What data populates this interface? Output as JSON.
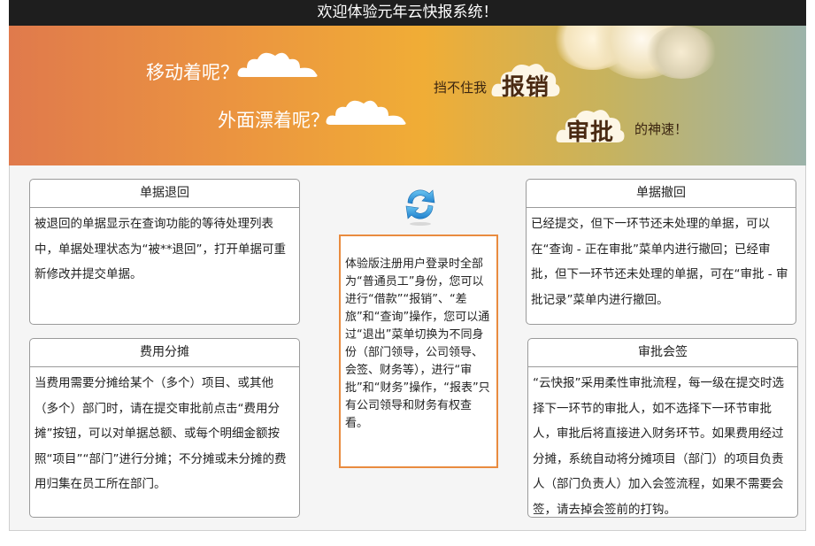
{
  "header": {
    "title": "欢迎体验元年云快报系统！"
  },
  "banner": {
    "line1": "移动着呢？",
    "line2": "外面漂着呢？",
    "cant_stop": "挡不住我",
    "word_reimburse": "报销",
    "word_approve": "审批",
    "speed": "的神速！"
  },
  "cards": {
    "returned": {
      "title": "单据退回",
      "body": "被退回的单据显示在查询功能的等待处理列表中，单据处理状态为“被**退回”，打开单据可重新修改并提交单据。"
    },
    "withdraw": {
      "title": "单据撤回",
      "body": "已经提交，但下一环节还未处理的单据，可以在“查询 - 正在审批”菜单内进行撤回；已经审批，但下一环节还未处理的单据，可在“审批 - 审批记录”菜单内进行撤回。"
    },
    "allocation": {
      "title": "费用分摊",
      "body": "当费用需要分摊给某个（多个）项目、或其他（多个）部门时，请在提交审批前点击“费用分摊”按钮，可以对单据总额、或每个明细金额按照“项目”“部门”进行分摊；不分摊或未分摊的费用归集在员工所在部门。"
    },
    "countersign": {
      "title": "审批会签",
      "body": "“云快报”采用柔性审批流程，每一级在提交时选择下一环节的审批人，如不选择下一环节审批人，审批后将直接进入财务环节。如果费用经过分摊，系统自动将分摊项目（部门）的项目负责人（部门负责人）加入会签流程，如果不需要会签，请去掉会签前的打钩。"
    }
  },
  "notice": {
    "body": "体验版注册用户登录时全部为“普通员工”身份，您可以进行“借款”“报销”、“差旅”和“查询”操作，您可以通过“退出”菜单切换为不同身份（部门领导，公司领导、会签、财务等），进行“审批”和“财务”操作，“报表”只有公司领导和财务有权查看。"
  },
  "icons": {
    "refresh": "refresh-icon",
    "clouds": "cloud-icon"
  },
  "colors": {
    "notice_border": "#e98b3f",
    "refresh_blue": "#2a8fd6",
    "title_bar": "#1e1e1e"
  }
}
